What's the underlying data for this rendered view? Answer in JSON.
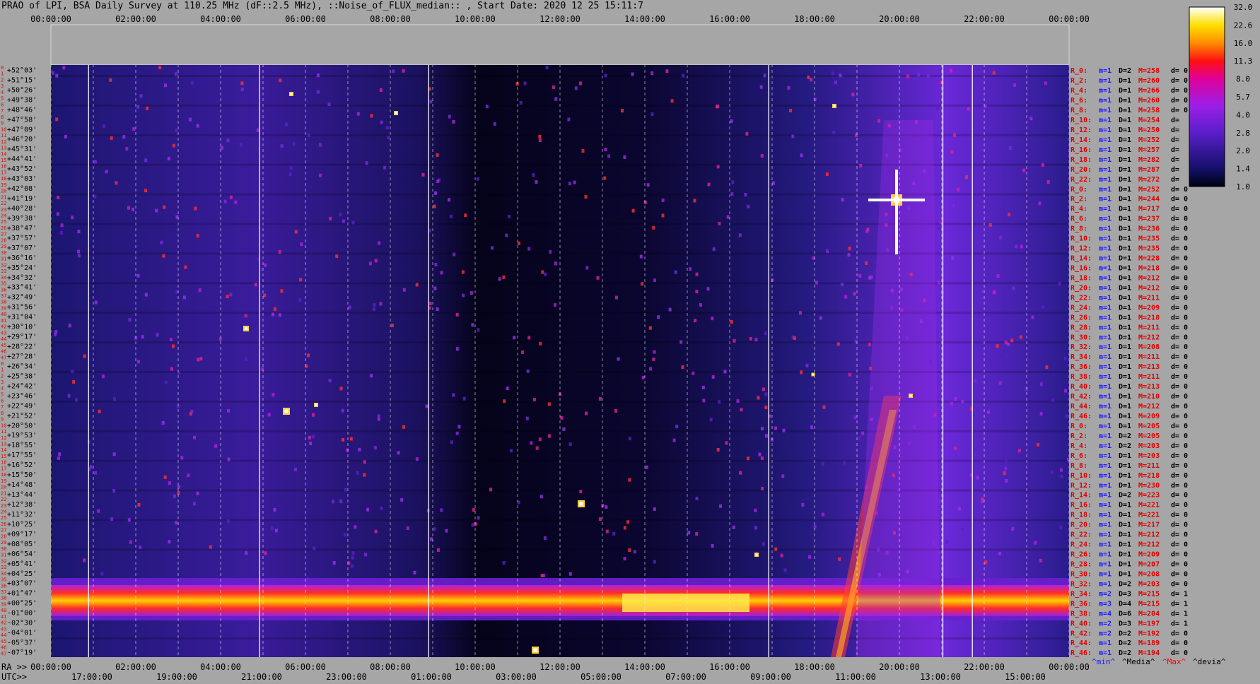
{
  "title": "PRAO of LPI, BSA Daily Survey at 110.25 MHz (dF::2.5 MHz), ::Noise_of_FLUX_median:: , Start Date: 2020 12 25 15:11:7",
  "chart_data": {
    "type": "heatmap",
    "title": "PRAO of LPI, BSA Daily Survey at 110.25 MHz (dF::2.5 MHz), ::Noise_of_FLUX_median:: , Start Date: 2020 12 25 15:11:7",
    "x_top_ticks": [
      "00:00:00",
      "02:00:00",
      "04:00:00",
      "06:00:00",
      "08:00:00",
      "10:00:00",
      "12:00:00",
      "14:00:00",
      "16:00:00",
      "18:00:00",
      "20:00:00",
      "22:00:00",
      "00:00:00"
    ],
    "x_ra_ticks": [
      "00:00:00",
      "02:00:00",
      "04:00:00",
      "06:00:00",
      "08:00:00",
      "10:00:00",
      "12:00:00",
      "14:00:00",
      "16:00:00",
      "18:00:00",
      "20:00:00",
      "22:00:00",
      "00:00:00"
    ],
    "x_utc_ticks": [
      "17:00:00",
      "19:00:00",
      "21:00:00",
      "23:00:00",
      "01:00:00",
      "03:00:00",
      "05:00:00",
      "07:00:00",
      "09:00:00",
      "11:00:00",
      "13:00:00",
      "15:00:00"
    ],
    "ra_label": "RA >>",
    "utc_label": "UTC>>",
    "beam_numbers": [
      "0",
      "1",
      "2",
      "3",
      "4",
      "5",
      "6",
      "7",
      "8",
      "9",
      "10",
      "11",
      "12",
      "13",
      "14",
      "15",
      "16",
      "17",
      "18",
      "19",
      "20",
      "21",
      "22",
      "23",
      "24",
      "25",
      "26",
      "27",
      "28",
      "29",
      "30",
      "31",
      "32",
      "33",
      "34",
      "35",
      "36",
      "37",
      "38",
      "39",
      "40",
      "41",
      "42",
      "43",
      "44",
      "45",
      "46",
      "47",
      "0",
      "1",
      "2",
      "3",
      "4",
      "5",
      "6",
      "7",
      "8",
      "9",
      "10",
      "11",
      "12",
      "13",
      "14",
      "15",
      "16",
      "17",
      "18",
      "19",
      "20",
      "21",
      "22",
      "23",
      "24",
      "25",
      "26",
      "27",
      "28",
      "29",
      "30",
      "31",
      "32",
      "33",
      "34",
      "35",
      "36",
      "37",
      "38",
      "39",
      "40",
      "41",
      "42",
      "43",
      "44",
      "45",
      "46",
      "47"
    ],
    "declinations": [
      "+52°03'",
      "+51°15'",
      "+50°26'",
      "+49°38'",
      "+48°46'",
      "+47°58'",
      "+47°09'",
      "+46°20'",
      "+45°31'",
      "+44°41'",
      "+43°52'",
      "+43°03'",
      "+42°08'",
      "+41°19'",
      "+40°28'",
      "+39°38'",
      "+38°47'",
      "+37°57'",
      "+37°07'",
      "+36°16'",
      "+35°24'",
      "+34°32'",
      "+33°41'",
      "+32°49'",
      "+31°56'",
      "+31°04'",
      "+30°10'",
      "+29°17'",
      "+28°22'",
      "+27°28'",
      "+26°34'",
      "+25°38'",
      "+24°42'",
      "+23°46'",
      "+22°49'",
      "+21°52'",
      "+20°50'",
      "+19°53'",
      "+18°55'",
      "+17°55'",
      "+16°52'",
      "+15°50'",
      "+14°48'",
      "+13°44'",
      "+12°38'",
      "+11°32'",
      "+10°25'",
      "+09°17'",
      "+08°05'",
      "+06°54'",
      "+05°41'",
      "+04°25'",
      "+03°07'",
      "+01°47'",
      "+00°25'",
      "-01°00'",
      "-02°30'",
      "-04°01'",
      "-05°37'",
      "-07°19'"
    ],
    "colorbar": {
      "ticks": [
        "32.0",
        "22.6",
        "16.0",
        "11.3",
        "8.0",
        "5.7",
        "4.0",
        "2.8",
        "2.0",
        "1.4",
        "1.0"
      ],
      "scale": "log2",
      "range": [
        1.0,
        32.0
      ]
    },
    "legend_footer": [
      {
        "text": "^min^",
        "color": "#1a1aff"
      },
      {
        "text": "^Media^",
        "color": "#000000"
      },
      {
        "text": "^Max^",
        "color": "#ff0000"
      },
      {
        "text": "^devia^",
        "color": "#000000"
      }
    ],
    "row_stats": [
      {
        "r": "R_0:",
        "m": "m=1",
        "D": "D=2",
        "M": "M=258",
        "d": "d= 0"
      },
      {
        "r": "R_2:",
        "m": "m=1",
        "D": "D=1",
        "M": "M=260",
        "d": "d= 0"
      },
      {
        "r": "R_4:",
        "m": "m=1",
        "D": "D=1",
        "M": "M=266",
        "d": "d= 0"
      },
      {
        "r": "R_6:",
        "m": "m=1",
        "D": "D=1",
        "M": "M=260",
        "d": "d= 0"
      },
      {
        "r": "R_8:",
        "m": "m=1",
        "D": "D=1",
        "M": "M=258",
        "d": "d= 0"
      },
      {
        "r": "R_10:",
        "m": "m=1",
        "D": "D=1",
        "M": "M=254",
        "d": "d="
      },
      {
        "r": "R_12:",
        "m": "m=1",
        "D": "D=1",
        "M": "M=250",
        "d": "d="
      },
      {
        "r": "R_14:",
        "m": "m=1",
        "D": "D=1",
        "M": "M=252",
        "d": "d="
      },
      {
        "r": "R_16:",
        "m": "m=1",
        "D": "D=1",
        "M": "M=257",
        "d": "d="
      },
      {
        "r": "R_18:",
        "m": "m=1",
        "D": "D=1",
        "M": "M=282",
        "d": "d="
      },
      {
        "r": "R_20:",
        "m": "m=1",
        "D": "D=1",
        "M": "M=287",
        "d": "d="
      },
      {
        "r": "R_22:",
        "m": "m=1",
        "D": "D=1",
        "M": "M=272",
        "d": "d="
      },
      {
        "r": "R_0:",
        "m": "m=1",
        "D": "D=1",
        "M": "M=252",
        "d": "d= 0"
      },
      {
        "r": "R_2:",
        "m": "m=1",
        "D": "D=1",
        "M": "M=244",
        "d": "d= 0"
      },
      {
        "r": "R_4:",
        "m": "m=1",
        "D": "D=1",
        "M": "M=717",
        "d": "d= 0"
      },
      {
        "r": "R_6:",
        "m": "m=1",
        "D": "D=1",
        "M": "M=237",
        "d": "d= 0"
      },
      {
        "r": "R_8:",
        "m": "m=1",
        "D": "D=1",
        "M": "M=236",
        "d": "d= 0"
      },
      {
        "r": "R_10:",
        "m": "m=1",
        "D": "D=1",
        "M": "M=235",
        "d": "d= 0"
      },
      {
        "r": "R_12:",
        "m": "m=1",
        "D": "D=1",
        "M": "M=235",
        "d": "d= 0"
      },
      {
        "r": "R_14:",
        "m": "m=1",
        "D": "D=1",
        "M": "M=228",
        "d": "d= 0"
      },
      {
        "r": "R_16:",
        "m": "m=1",
        "D": "D=1",
        "M": "M=218",
        "d": "d= 0"
      },
      {
        "r": "R_18:",
        "m": "m=1",
        "D": "D=1",
        "M": "M=212",
        "d": "d= 0"
      },
      {
        "r": "R_20:",
        "m": "m=1",
        "D": "D=1",
        "M": "M=212",
        "d": "d= 0"
      },
      {
        "r": "R_22:",
        "m": "m=1",
        "D": "D=1",
        "M": "M=211",
        "d": "d= 0"
      },
      {
        "r": "R_24:",
        "m": "m=1",
        "D": "D=1",
        "M": "M=209",
        "d": "d= 0"
      },
      {
        "r": "R_26:",
        "m": "m=1",
        "D": "D=1",
        "M": "M=218",
        "d": "d= 0"
      },
      {
        "r": "R_28:",
        "m": "m=1",
        "D": "D=1",
        "M": "M=211",
        "d": "d= 0"
      },
      {
        "r": "R_30:",
        "m": "m=1",
        "D": "D=1",
        "M": "M=212",
        "d": "d= 0"
      },
      {
        "r": "R_32:",
        "m": "m=1",
        "D": "D=1",
        "M": "M=208",
        "d": "d= 0"
      },
      {
        "r": "R_34:",
        "m": "m=1",
        "D": "D=1",
        "M": "M=211",
        "d": "d= 0"
      },
      {
        "r": "R_36:",
        "m": "m=1",
        "D": "D=1",
        "M": "M=213",
        "d": "d= 0"
      },
      {
        "r": "R_38:",
        "m": "m=1",
        "D": "D=1",
        "M": "M=211",
        "d": "d= 0"
      },
      {
        "r": "R_40:",
        "m": "m=1",
        "D": "D=1",
        "M": "M=213",
        "d": "d= 0"
      },
      {
        "r": "R_42:",
        "m": "m=1",
        "D": "D=1",
        "M": "M=210",
        "d": "d= 0"
      },
      {
        "r": "R_44:",
        "m": "m=1",
        "D": "D=1",
        "M": "M=212",
        "d": "d= 0"
      },
      {
        "r": "R_46:",
        "m": "m=1",
        "D": "D=1",
        "M": "M=209",
        "d": "d= 0"
      },
      {
        "r": "R_0:",
        "m": "m=1",
        "D": "D=1",
        "M": "M=205",
        "d": "d= 0"
      },
      {
        "r": "R_2:",
        "m": "m=1",
        "D": "D=2",
        "M": "M=205",
        "d": "d= 0"
      },
      {
        "r": "R_4:",
        "m": "m=1",
        "D": "D=2",
        "M": "M=203",
        "d": "d= 0"
      },
      {
        "r": "R_6:",
        "m": "m=1",
        "D": "D=1",
        "M": "M=203",
        "d": "d= 0"
      },
      {
        "r": "R_8:",
        "m": "m=1",
        "D": "D=1",
        "M": "M=211",
        "d": "d= 0"
      },
      {
        "r": "R_10:",
        "m": "m=1",
        "D": "D=1",
        "M": "M=218",
        "d": "d= 0"
      },
      {
        "r": "R_12:",
        "m": "m=1",
        "D": "D=1",
        "M": "M=230",
        "d": "d= 0"
      },
      {
        "r": "R_14:",
        "m": "m=1",
        "D": "D=2",
        "M": "M=223",
        "d": "d= 0"
      },
      {
        "r": "R_16:",
        "m": "m=1",
        "D": "D=1",
        "M": "M=221",
        "d": "d= 0"
      },
      {
        "r": "R_18:",
        "m": "m=1",
        "D": "D=1",
        "M": "M=221",
        "d": "d= 0"
      },
      {
        "r": "R_20:",
        "m": "m=1",
        "D": "D=1",
        "M": "M=217",
        "d": "d= 0"
      },
      {
        "r": "R_22:",
        "m": "m=1",
        "D": "D=1",
        "M": "M=212",
        "d": "d= 0"
      },
      {
        "r": "R_24:",
        "m": "m=1",
        "D": "D=1",
        "M": "M=212",
        "d": "d= 0"
      },
      {
        "r": "R_26:",
        "m": "m=1",
        "D": "D=1",
        "M": "M=209",
        "d": "d= 0"
      },
      {
        "r": "R_28:",
        "m": "m=1",
        "D": "D=1",
        "M": "M=207",
        "d": "d= 0"
      },
      {
        "r": "R_30:",
        "m": "m=1",
        "D": "D=1",
        "M": "M=208",
        "d": "d= 0"
      },
      {
        "r": "R_32:",
        "m": "m=1",
        "D": "D=2",
        "M": "M=203",
        "d": "d= 0"
      },
      {
        "r": "R_34:",
        "m": "m=2",
        "D": "D=3",
        "M": "M=215",
        "d": "d= 1"
      },
      {
        "r": "R_36:",
        "m": "m=3",
        "D": "D=4",
        "M": "M=215",
        "d": "d= 1"
      },
      {
        "r": "R_38:",
        "m": "m=4",
        "D": "D=6",
        "M": "M=204",
        "d": "d= 1"
      },
      {
        "r": "R_40:",
        "m": "m=2",
        "D": "D=3",
        "M": "M=197",
        "d": "d= 1"
      },
      {
        "r": "R_42:",
        "m": "m=2",
        "D": "D=2",
        "M": "M=192",
        "d": "d= 0"
      },
      {
        "r": "R_44:",
        "m": "m=1",
        "D": "D=2",
        "M": "M=189",
        "d": "d= 0"
      },
      {
        "r": "R_46:",
        "m": "m=1",
        "D": "D=2",
        "M": "M=194",
        "d": "d= 0"
      }
    ]
  }
}
